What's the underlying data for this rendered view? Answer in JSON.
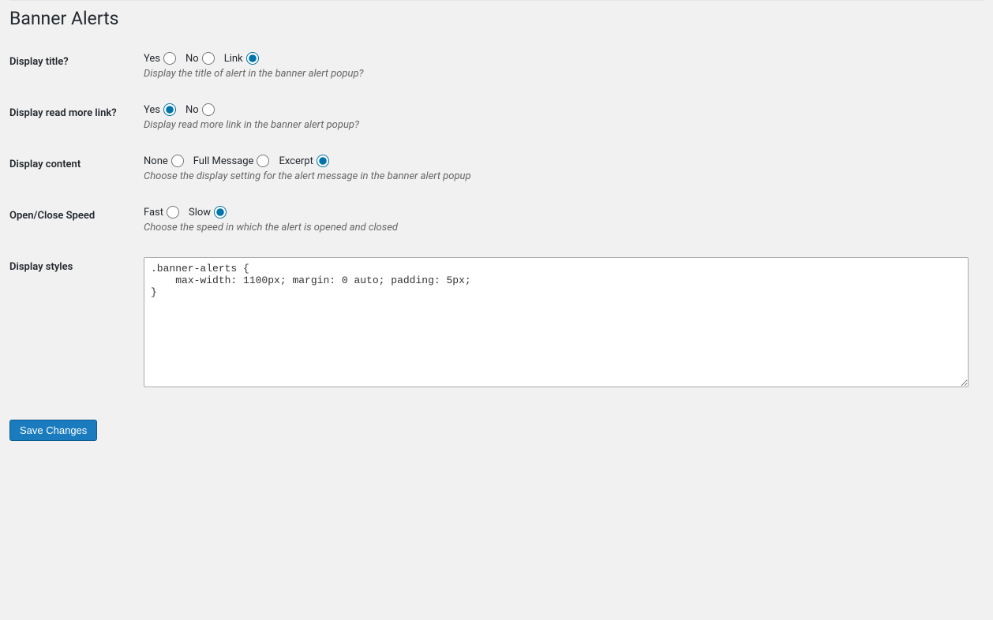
{
  "page": {
    "title": "Banner Alerts"
  },
  "fields": {
    "display_title": {
      "label": "Display title?",
      "options": {
        "yes": "Yes",
        "no": "No",
        "link": "Link"
      },
      "description": "Display the title of alert in the banner alert popup?"
    },
    "display_read_more": {
      "label": "Display read more link?",
      "options": {
        "yes": "Yes",
        "no": "No"
      },
      "description": "Display read more link in the banner alert popup?"
    },
    "display_content": {
      "label": "Display content",
      "options": {
        "none": "None",
        "full": "Full Message",
        "excerpt": "Excerpt"
      },
      "description": "Choose the display setting for the alert message in the banner alert popup"
    },
    "speed": {
      "label": "Open/Close Speed",
      "options": {
        "fast": "Fast",
        "slow": "Slow"
      },
      "description": "Choose the speed in which the alert is opened and closed"
    },
    "styles": {
      "label": "Display styles",
      "value": ".banner-alerts {\n    max-width: 1100px; margin: 0 auto; padding: 5px;\n}"
    }
  },
  "buttons": {
    "save": "Save Changes"
  }
}
